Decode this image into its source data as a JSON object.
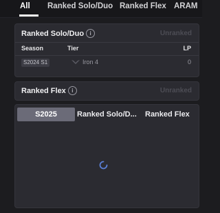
{
  "tabs": [
    {
      "label": "All",
      "active": true
    },
    {
      "label": "Ranked Solo/Duo",
      "active": false
    },
    {
      "label": "Ranked Flex",
      "active": false
    },
    {
      "label": "ARAM",
      "active": false
    }
  ],
  "solo_card": {
    "title": "Ranked Solo/Duo",
    "info_icon": "info-icon",
    "status": "Unranked",
    "columns": {
      "season": "Season",
      "tier": "Tier",
      "lp": "LP"
    },
    "rows": [
      {
        "season": "S2024 S1",
        "tier": "Iron 4",
        "lp": "0",
        "tier_icon": "iron-rank-icon"
      }
    ]
  },
  "flex_card": {
    "title": "Ranked Flex",
    "info_icon": "info-icon",
    "status": "Unranked"
  },
  "history_card": {
    "segments": [
      {
        "label": "S2025",
        "active": true
      },
      {
        "label": "Ranked Solo/D...",
        "active": false
      },
      {
        "label": "Ranked Flex",
        "active": false
      }
    ],
    "loading_icon": "spinner-icon"
  },
  "colors": {
    "accent": "#6b6b78",
    "spinner": "#5a7fd6",
    "muted": "#4d4d55"
  }
}
